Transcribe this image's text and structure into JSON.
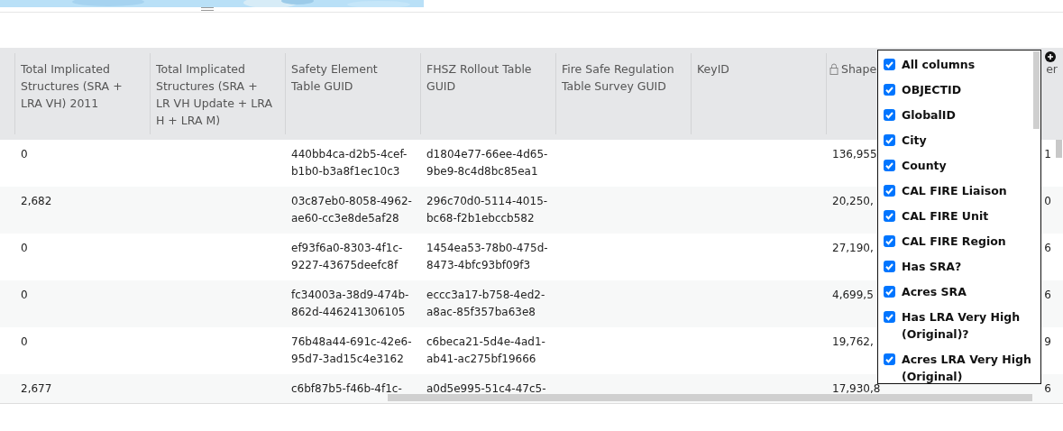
{
  "table": {
    "columns": [
      {
        "label": "Total Implicated Structures (SRA + LRA VH) 2011"
      },
      {
        "label": "Total Implicated Structures (SRA + LR VH Update + LRA H + LRA M)"
      },
      {
        "label": "Safety Element Table GUID"
      },
      {
        "label": "FHSZ Rollout Table GUID"
      },
      {
        "label": "Fire Safe Regulation Table Survey GUID"
      },
      {
        "label": "KeyID"
      },
      {
        "label": "Shape",
        "locked": true
      },
      {
        "label": "er"
      }
    ],
    "rows": [
      {
        "cells": [
          "0",
          "",
          "440bb4ca-d2b5-4cef-b1b0-b3a8f1ec10c3",
          "d1804e77-66ee-4d65-9be9-8c4d8bc85ea1",
          "",
          "",
          "136,955",
          "1"
        ]
      },
      {
        "cells": [
          "2,682",
          "",
          "03c87eb0-8058-4962-ae60-cc3e8de5af28",
          "296c70d0-5114-4015-bc68-f2b1ebccb582",
          "",
          "",
          "20,250,",
          "0"
        ]
      },
      {
        "cells": [
          "0",
          "",
          "ef93f6a0-8303-4f1c-9227-43675deefc8f",
          "1454ea53-78b0-475d-8473-4bfc93bf09f3",
          "",
          "",
          "27,190,",
          "6"
        ]
      },
      {
        "cells": [
          "0",
          "",
          "fc34003a-38d9-474b-862d-446241306105",
          "eccc3a17-b758-4ed2-a8ac-85f357ba63e8",
          "",
          "",
          "4,699,5",
          "6"
        ]
      },
      {
        "cells": [
          "0",
          "",
          "76b48a44-691c-42e6-95d7-3ad15c4e3162",
          "c6beca21-5d4e-4ad1-ab41-ac275bf19666",
          "",
          "",
          "19,762,",
          "9"
        ]
      },
      {
        "cells": [
          "2,677",
          "",
          "c6bf87b5-f46b-4f1c-",
          "a0d5e995-51c4-47c5-",
          "",
          "",
          "17,930,8",
          "6"
        ]
      }
    ]
  },
  "column_menu": {
    "items": [
      {
        "label": "All columns",
        "checked": true
      },
      {
        "label": "OBJECTID",
        "checked": true
      },
      {
        "label": "GlobalID",
        "checked": true
      },
      {
        "label": "City",
        "checked": true
      },
      {
        "label": "County",
        "checked": true
      },
      {
        "label": "CAL FIRE Liaison",
        "checked": true
      },
      {
        "label": "CAL FIRE Unit",
        "checked": true
      },
      {
        "label": "CAL FIRE Region",
        "checked": true
      },
      {
        "label": "Has SRA?",
        "checked": true
      },
      {
        "label": "Acres SRA",
        "checked": true
      },
      {
        "label": "Has LRA Very High (Original)?",
        "checked": true
      },
      {
        "label": "Acres LRA Very High (Original)",
        "checked": true
      }
    ]
  }
}
